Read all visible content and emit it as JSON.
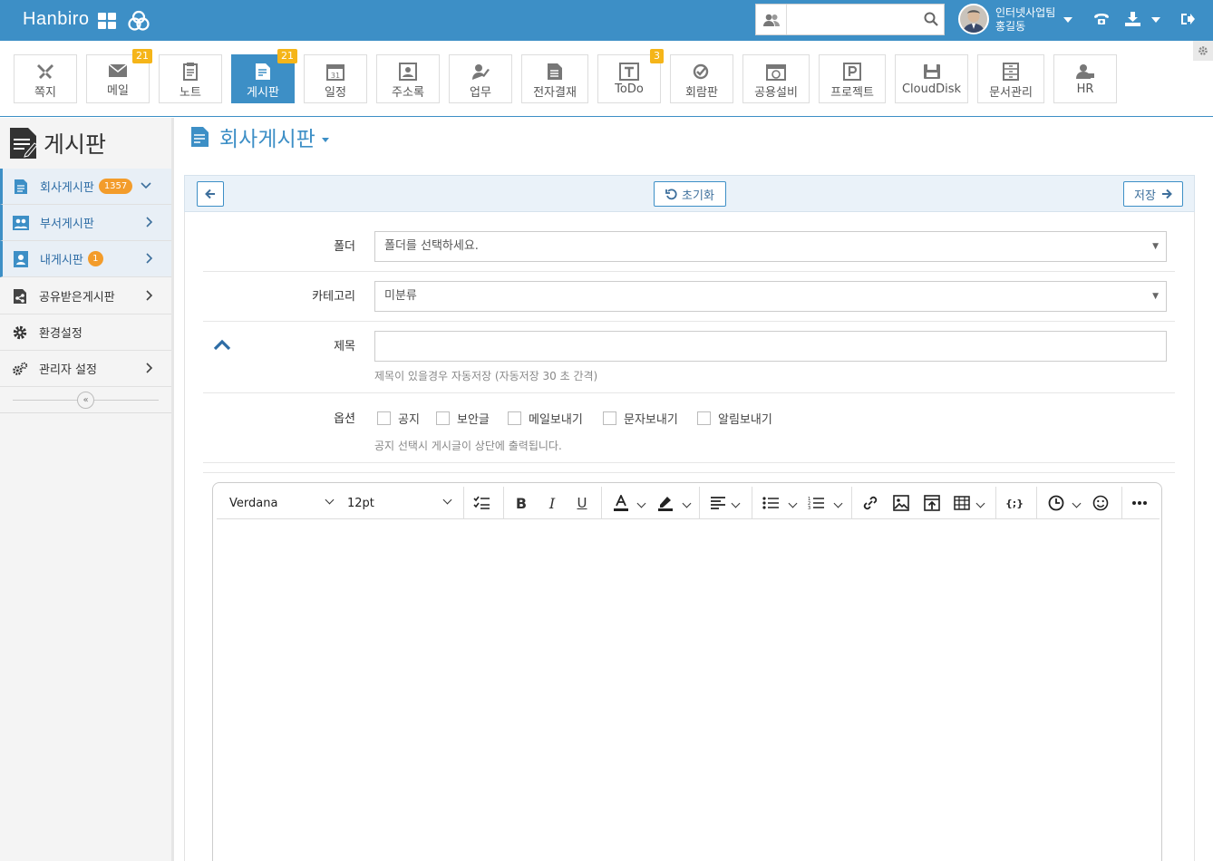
{
  "header": {
    "brand": "Hanbiro",
    "search_placeholder": "",
    "user_dept": "인터넷사업팀",
    "user_name": "홍길동",
    "icons": [
      "grid-icon",
      "hanbiro-logo-icon",
      "people-icon",
      "search-icon",
      "avatar",
      "caret-down-icon",
      "phone-icon",
      "download-icon",
      "logout-icon"
    ],
    "color": "#3d8fc6"
  },
  "apps": [
    {
      "label": "쪽지",
      "badge": ""
    },
    {
      "label": "메일",
      "badge": "21"
    },
    {
      "label": "노트",
      "badge": ""
    },
    {
      "label": "게시판",
      "badge": "21",
      "active": true
    },
    {
      "label": "일정",
      "badge": ""
    },
    {
      "label": "주소록",
      "badge": ""
    },
    {
      "label": "업무",
      "badge": ""
    },
    {
      "label": "전자결재",
      "badge": ""
    },
    {
      "label": "ToDo",
      "badge": "3"
    },
    {
      "label": "회람판",
      "badge": ""
    },
    {
      "label": "공용설비",
      "badge": ""
    },
    {
      "label": "프로젝트",
      "badge": ""
    },
    {
      "label": "CloudDisk",
      "badge": ""
    },
    {
      "label": "문서관리",
      "badge": ""
    },
    {
      "label": "HR",
      "badge": ""
    }
  ],
  "sidebar": {
    "title": "게시판",
    "items": [
      {
        "label": "회사게시판",
        "count": "1357"
      },
      {
        "label": "부서게시판",
        "count": ""
      },
      {
        "label": "내게시판",
        "count": "1"
      },
      {
        "label": "공유받은게시판",
        "count": ""
      },
      {
        "label": "환경설정",
        "count": ""
      },
      {
        "label": "관리자 설정",
        "count": ""
      }
    ]
  },
  "main": {
    "title": "회사게시판",
    "toolbar": {
      "reset": "초기화",
      "save": "저장"
    },
    "form": {
      "folder_label": "폴더",
      "folder_value": "폴더를 선택하세요.",
      "category_label": "카테고리",
      "category_value": "미분류",
      "subject_label": "제목",
      "subject_value": "",
      "subject_hint": "제목이 있을경우 자동저장 (자동저장 30 초 간격)",
      "options_label": "옵션",
      "options": [
        "공지",
        "보안글",
        "메일보내기",
        "문자보내기",
        "알림보내기"
      ],
      "options_hint": "공지 선택시 게시글이 상단에 출력됩니다."
    },
    "editor": {
      "font": "Verdana",
      "size": "12pt"
    }
  }
}
